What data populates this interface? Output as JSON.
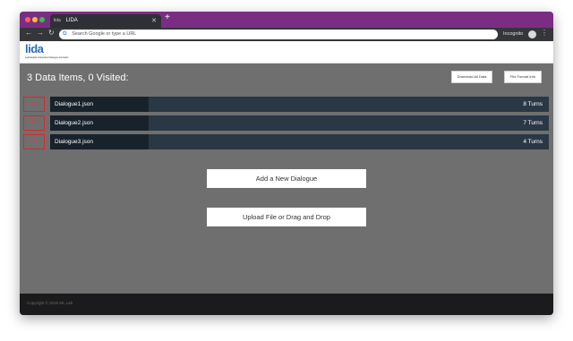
{
  "browser": {
    "tab_title": "LIDA",
    "tab_favicon_text": "lida",
    "new_tab_symbol": "+",
    "omnibox_placeholder": "Search Google or type a URL",
    "profile_label": "Incognito",
    "icons": {
      "back": "arrow-left-icon",
      "forward": "arrow-right-icon",
      "reload": "reload-icon",
      "google": "google-g-icon",
      "menu": "kebab-menu-icon",
      "close": "close-icon"
    }
  },
  "app": {
    "logo_text": "lida",
    "tagline": "Lightweight Interactive Dialogue Annotator",
    "logo_color": "#2a6cb7"
  },
  "main": {
    "summary": "3 Data Items, 0 Visited:",
    "download_label": "Download All Data",
    "format_info_label": "File Format Info",
    "items": [
      {
        "delete_label": "Del",
        "name": "Dialogue1.json",
        "turns": "8 Turns"
      },
      {
        "delete_label": "Del",
        "name": "Dialogue2.json",
        "turns": "7 Turns"
      },
      {
        "delete_label": "Del",
        "name": "Dialogue3.json",
        "turns": "4 Turns"
      }
    ],
    "add_label": "Add a New Dialogue",
    "upload_label": "Upload File or Drag and Drop"
  },
  "footer": {
    "text": "Copyright © 2019 ML Lab"
  },
  "colors": {
    "tab_strip": "#7b2d83",
    "delete_accent": "#d42a2a",
    "row_bar": "#2a3845",
    "background": "#6f6f6f"
  }
}
